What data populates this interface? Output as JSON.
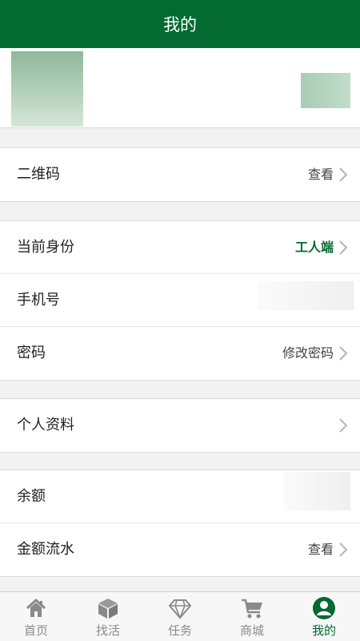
{
  "header": {
    "title": "我的"
  },
  "sections": {
    "qr": {
      "label": "二维码",
      "value": "查看"
    },
    "identity": {
      "label": "当前身份",
      "value": "工人端"
    },
    "phone": {
      "label": "手机号",
      "value": ""
    },
    "password": {
      "label": "密码",
      "value": "修改密码"
    },
    "profile_info": {
      "label": "个人资料",
      "value": ""
    },
    "balance": {
      "label": "余额",
      "value": ""
    },
    "flow": {
      "label": "金额流水",
      "value": "查看"
    }
  },
  "tabbar": {
    "items": [
      {
        "label": "首页",
        "icon": "home-icon"
      },
      {
        "label": "找活",
        "icon": "box-icon"
      },
      {
        "label": "任务",
        "icon": "diamond-icon"
      },
      {
        "label": "商城",
        "icon": "cart-icon"
      },
      {
        "label": "我的",
        "icon": "user-icon",
        "active": true
      }
    ]
  },
  "colors": {
    "brand": "#036a31",
    "background": "#f2f2f2",
    "inactive_tab": "#8a8a8a"
  }
}
